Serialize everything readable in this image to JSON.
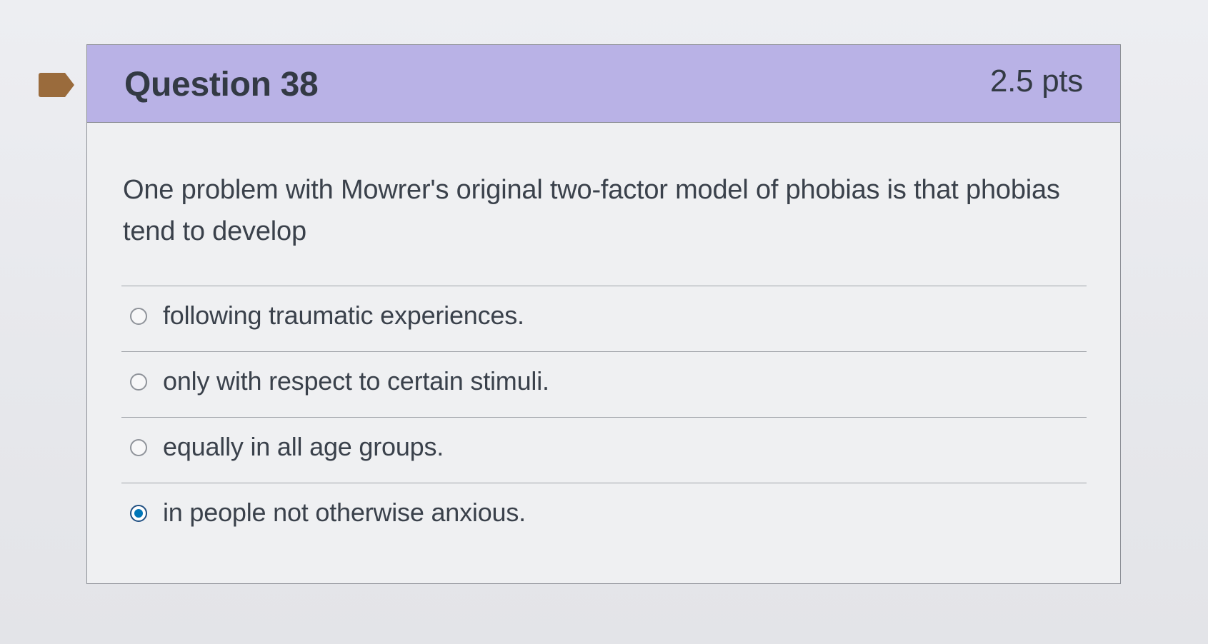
{
  "question": {
    "title": "Question 38",
    "points": "2.5 pts",
    "prompt": "One problem with Mowrer's original two-factor model of phobias is that phobias tend to develop",
    "answers": [
      {
        "label": "following traumatic experiences.",
        "selected": false
      },
      {
        "label": "only with respect to certain stimuli.",
        "selected": false
      },
      {
        "label": "equally in all age groups.",
        "selected": false
      },
      {
        "label": "in people not otherwise anxious.",
        "selected": true
      }
    ]
  },
  "colors": {
    "header_bg": "#b9b2e6",
    "bookmark": "#9a6b3c",
    "radio_selected": "#0076b8"
  },
  "icons": {
    "bookmark": "bookmark-flag-icon",
    "radio_unselected": "radio-unchecked-icon",
    "radio_selected": "radio-checked-icon"
  }
}
